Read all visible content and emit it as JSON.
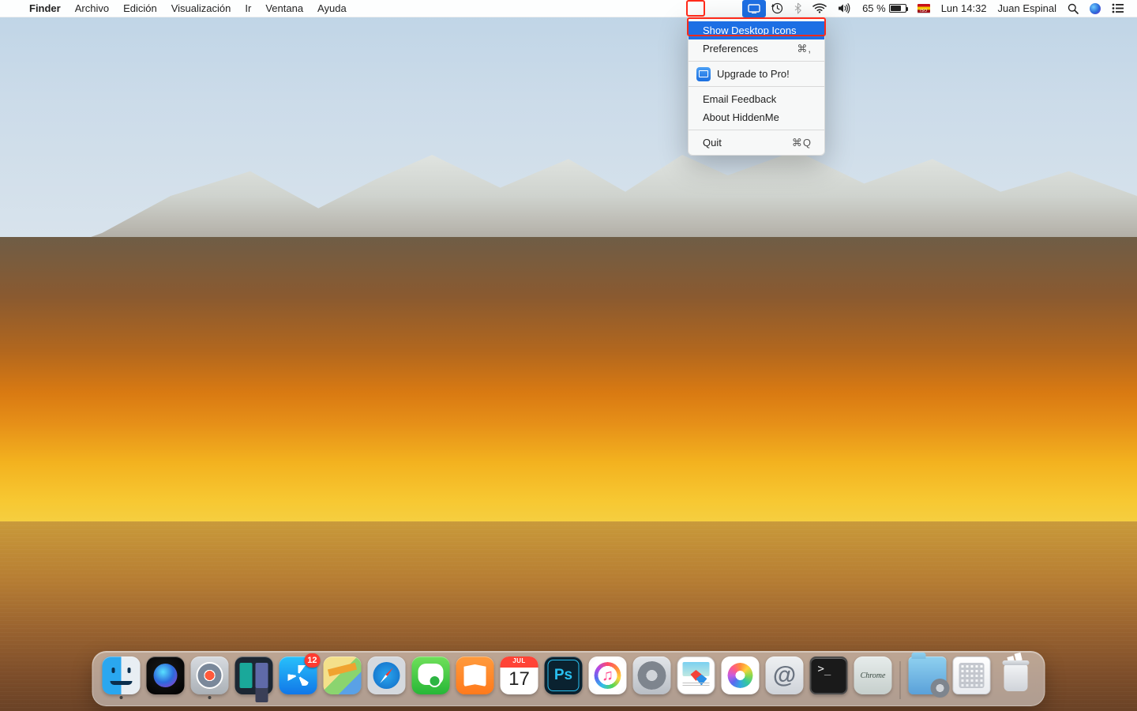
{
  "menubar": {
    "app": "Finder",
    "items": [
      "Archivo",
      "Edición",
      "Visualización",
      "Ir",
      "Ventana",
      "Ayuda"
    ],
    "status": {
      "battery_pct": "65 %",
      "clock": "Lun 14:32",
      "user": "Juan Espinal",
      "flag_label": "ES"
    }
  },
  "dropdown": {
    "items": [
      {
        "label": "Show Desktop Icons",
        "selected": true
      },
      {
        "label": "Preferences",
        "shortcut": "⌘,"
      },
      {
        "sep": true
      },
      {
        "label": "Upgrade to Pro!",
        "icon": true
      },
      {
        "sep": true
      },
      {
        "label": "Email Feedback"
      },
      {
        "label": "About HiddenMe"
      },
      {
        "sep": true
      },
      {
        "label": "Quit",
        "shortcut": "⌘Q"
      }
    ]
  },
  "calendar": {
    "month": "JUL",
    "day": "17"
  },
  "dock": {
    "badge_appstore": "12",
    "items": [
      {
        "name": "finder",
        "running": true
      },
      {
        "name": "siri",
        "running": false
      },
      {
        "name": "launchpad",
        "running": true
      },
      {
        "name": "mission-control",
        "running": false
      },
      {
        "name": "app-store",
        "running": false,
        "badge": "12"
      },
      {
        "name": "maps",
        "running": false
      },
      {
        "name": "safari",
        "running": false
      },
      {
        "name": "messages",
        "running": false
      },
      {
        "name": "books",
        "running": false
      },
      {
        "name": "calendar",
        "running": false
      },
      {
        "name": "photoshop",
        "running": false
      },
      {
        "name": "itunes",
        "running": false
      },
      {
        "name": "system-preferences",
        "running": false
      },
      {
        "name": "guides",
        "running": false
      },
      {
        "name": "photos",
        "running": false
      },
      {
        "name": "mail-at",
        "running": false
      },
      {
        "name": "terminal",
        "running": false
      },
      {
        "name": "chrome",
        "running": false
      },
      {
        "sep": true
      },
      {
        "name": "utilities-folder",
        "running": false
      },
      {
        "name": "keyboard-viewer",
        "running": false
      },
      {
        "name": "trash",
        "running": false
      }
    ]
  }
}
